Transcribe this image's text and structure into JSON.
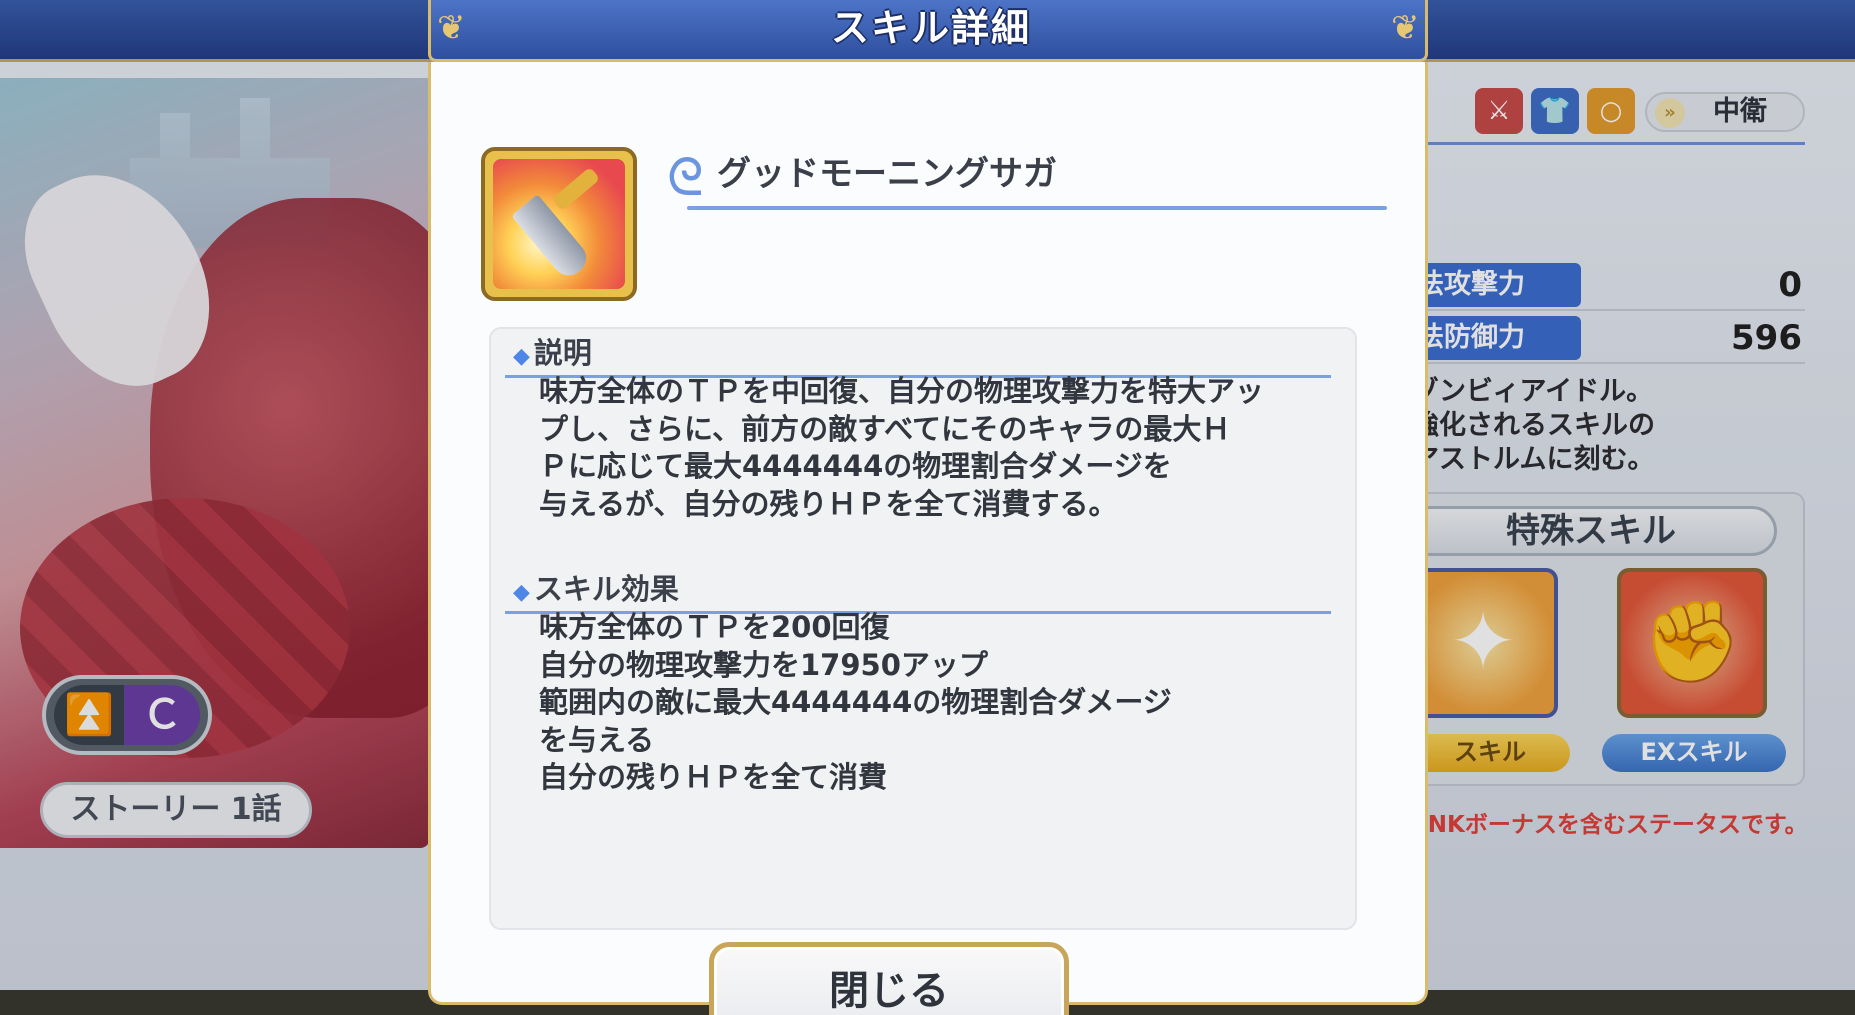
{
  "modal": {
    "title": "スキル詳細",
    "skill_name": "グッドモーニングサガ",
    "sections": [
      {
        "heading": "説明",
        "lines": [
          "味方全体のＴＰを中回復、自分の物理攻撃力を特大アッ",
          "プし、さらに、前方の敵すべてにそのキャラの最大Ｈ",
          "Ｐに応じて最大4444444の物理割合ダメージを",
          "与えるが、自分の残りＨＰを全て消費する。"
        ]
      },
      {
        "heading": "スキル効果",
        "lines": [
          "味方全体のＴＰを200回復",
          "自分の物理攻撃力を17950アップ",
          "範囲内の敵に最大4444444の物理割合ダメージ",
          "を与える",
          "自分の残りＨＰを全て消費"
        ]
      }
    ],
    "close_label": "閉じる"
  },
  "background": {
    "story_label": "ストーリー 1話",
    "position_label": "中衛",
    "stats": [
      {
        "label": "法攻撃力",
        "value": "0"
      },
      {
        "label": "法防御力",
        "value": "596"
      }
    ],
    "profile_lines": [
      "ゾンビィアイドル。",
      "強化されるスキルの",
      "アストルムに刻む。"
    ],
    "special_skill_title": "特殊スキル",
    "skill_tags": [
      "スキル",
      "EXスキル"
    ],
    "rank_note": "ANKボーナスを含むステータスです。"
  },
  "colors": {
    "header_blue": "#3a62b8",
    "gold_border": "#d9bc6a",
    "accent_line": "#7aa0e0",
    "stat_label_blue": "#3c6fd1",
    "note_red": "#e0413c"
  },
  "icons": {
    "skill_main": "sword-slash-icon",
    "special_skill_a": "power-up-person-icon",
    "special_skill_b": "fist-icon"
  }
}
